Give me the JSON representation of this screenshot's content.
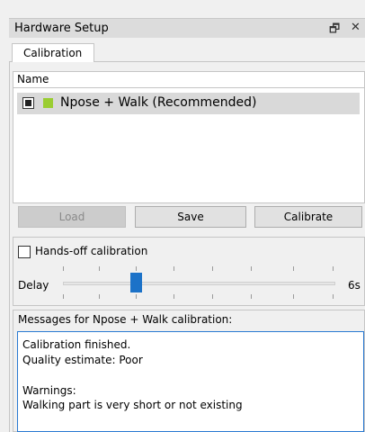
{
  "window": {
    "title": "Hardware Setup",
    "float_icon": "restore-icon",
    "close_icon": "close-icon"
  },
  "tabs": [
    {
      "label": "Calibration",
      "active": true
    }
  ],
  "list": {
    "column_header": "Name",
    "rows": [
      {
        "label": "Npose + Walk (Recommended)",
        "checked": true,
        "color": "#9acd32",
        "selected": true
      }
    ]
  },
  "buttons": {
    "load": "Load",
    "save": "Save",
    "calibrate": "Calibrate"
  },
  "handsoff": {
    "label": "Hands-off calibration",
    "checked": false
  },
  "delay": {
    "label": "Delay",
    "max_label": "6s",
    "value": 1
  },
  "messages": {
    "title": "Messages for Npose + Walk calibration:",
    "lines": [
      "Calibration finished.",
      "Quality estimate: Poor",
      "",
      "Warnings:",
      "Walking part is very short or not existing"
    ]
  },
  "colors": {
    "accent": "#1c72c8",
    "selection": "#d9d9d9"
  }
}
